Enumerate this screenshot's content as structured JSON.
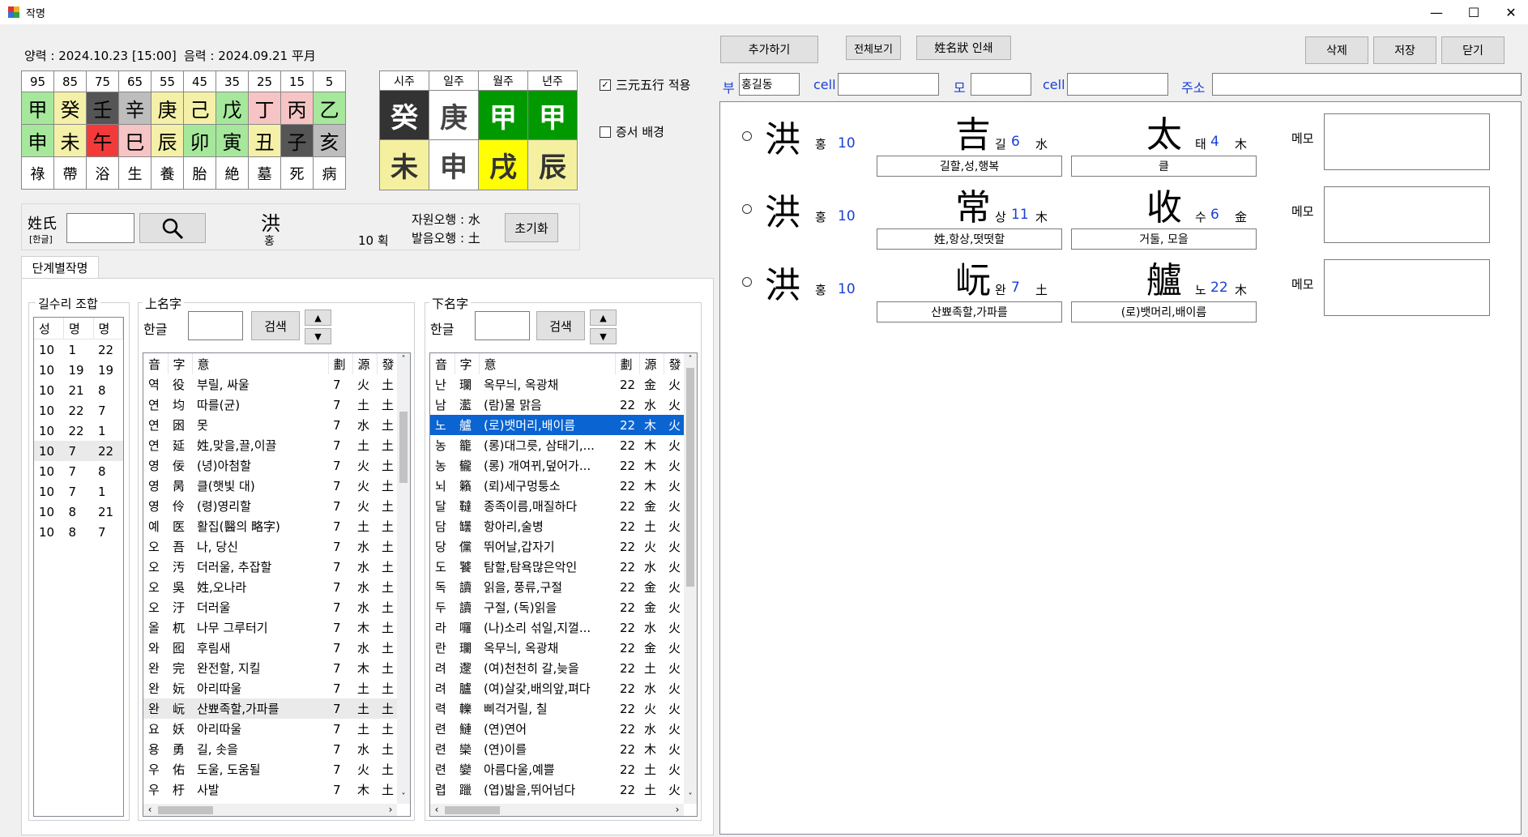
{
  "window": {
    "title": "작명",
    "min": "—",
    "max": "☐",
    "close": "✕"
  },
  "header": {
    "solar_label": "양력 : 2024.10.23 [15:00]",
    "lunar_label": "음력 : 2024.09.21 平月"
  },
  "daewoon": {
    "ages": [
      "95",
      "85",
      "75",
      "65",
      "55",
      "45",
      "35",
      "25",
      "15",
      "5"
    ],
    "stems": [
      "甲",
      "癸",
      "壬",
      "辛",
      "庚",
      "己",
      "戊",
      "丁",
      "丙",
      "乙"
    ],
    "branches": [
      "申",
      "未",
      "午",
      "巳",
      "辰",
      "卯",
      "寅",
      "丑",
      "子",
      "亥"
    ],
    "states": [
      "祿",
      "帶",
      "浴",
      "生",
      "養",
      "胎",
      "絶",
      "墓",
      "死",
      "病"
    ],
    "stem_colors": [
      "#a6e89b",
      "#f4f0a8",
      "#555555",
      "#bdbdbd",
      "#f4f0a8",
      "#f4f0a8",
      "#a6e89b",
      "#f6c4c4",
      "#f6c4c4",
      "#a6e89b"
    ],
    "branch_colors": [
      "#a6e89b",
      "#f4f0a8",
      "#f33a3a",
      "#f6c4c4",
      "#f4f0a8",
      "#a6e89b",
      "#a6e89b",
      "#f4f0a8",
      "#555555",
      "#bdbdbd"
    ]
  },
  "pillars": {
    "headers": [
      "시주",
      "일주",
      "월주",
      "년주"
    ],
    "stems": [
      "癸",
      "庚",
      "甲",
      "甲"
    ],
    "branches": [
      "未",
      "申",
      "戌",
      "辰"
    ],
    "stem_bg": [
      "#333333",
      "#ffffff",
      "#009a00",
      "#009a00"
    ],
    "stem_fg": [
      "#ffffff",
      "#444444",
      "#ffffff",
      "#ffffff"
    ],
    "branch_bg": [
      "#f4f0a0",
      "#ffffff",
      "#ffff00",
      "#f4f0a0"
    ],
    "branch_fg": [
      "#333333",
      "#444444",
      "#333333",
      "#333333"
    ]
  },
  "options": {
    "opt1": "三元五行 적용",
    "opt2": "증서 배경"
  },
  "surname": {
    "label": "姓氏",
    "sub": "[한글]",
    "value": "",
    "hanja": "洪",
    "reading": "홍",
    "strokes": "10 획",
    "jawon": "자원오행 : 水",
    "balum": "발음오행 : 土",
    "reset": "초기화"
  },
  "tab": {
    "label": "단계별작명"
  },
  "gilsu": {
    "title": "길수리 조합",
    "headers": [
      "성",
      "명",
      "명"
    ],
    "rows": [
      [
        "10",
        "1",
        "22"
      ],
      [
        "10",
        "19",
        "19"
      ],
      [
        "10",
        "21",
        "8"
      ],
      [
        "10",
        "22",
        "7"
      ],
      [
        "10",
        "22",
        "1"
      ],
      [
        "10",
        "7",
        "22"
      ],
      [
        "10",
        "7",
        "8"
      ],
      [
        "10",
        "7",
        "1"
      ],
      [
        "10",
        "8",
        "21"
      ],
      [
        "10",
        "8",
        "7"
      ]
    ]
  },
  "upper": {
    "title": "上名字",
    "hangul_label": "한글",
    "search": "검색",
    "headers": [
      "音",
      "字",
      "意",
      "劃",
      "源",
      "發"
    ],
    "rows": [
      [
        "역",
        "役",
        "부릴, 싸울",
        "7",
        "火",
        "土"
      ],
      [
        "연",
        "均",
        "따를(균)",
        "7",
        "土",
        "土"
      ],
      [
        "연",
        "囦",
        "못",
        "7",
        "水",
        "土"
      ],
      [
        "연",
        "延",
        "姓,맞을,끌,이끌",
        "7",
        "土",
        "土"
      ],
      [
        "영",
        "佞",
        "(녕)아첨할",
        "7",
        "火",
        "土"
      ],
      [
        "영",
        "昺",
        "클(햇빛 대)",
        "7",
        "火",
        "土"
      ],
      [
        "영",
        "伶",
        "(령)영리할",
        "7",
        "火",
        "土"
      ],
      [
        "예",
        "医",
        "활집(醫의 略字)",
        "7",
        "土",
        "土"
      ],
      [
        "오",
        "吾",
        "나, 당신",
        "7",
        "水",
        "土"
      ],
      [
        "오",
        "汚",
        "더러울, 추잡할",
        "7",
        "水",
        "土"
      ],
      [
        "오",
        "吳",
        "姓,오나라",
        "7",
        "水",
        "土"
      ],
      [
        "오",
        "汙",
        "더러울",
        "7",
        "水",
        "土"
      ],
      [
        "올",
        "杌",
        "나무 그루터기",
        "7",
        "木",
        "土"
      ],
      [
        "와",
        "囮",
        "후림새",
        "7",
        "水",
        "土"
      ],
      [
        "완",
        "完",
        "완전할, 지킬",
        "7",
        "木",
        "土"
      ],
      [
        "완",
        "妧",
        "아리따울",
        "7",
        "土",
        "土"
      ],
      [
        "완",
        "岏",
        "산뾰족할,가파를",
        "7",
        "土",
        "土"
      ],
      [
        "요",
        "妖",
        "아리따울",
        "7",
        "土",
        "土"
      ],
      [
        "용",
        "勇",
        "길, 솟을",
        "7",
        "水",
        "土"
      ],
      [
        "우",
        "佑",
        "도울, 도움될",
        "7",
        "火",
        "土"
      ],
      [
        "우",
        "杅",
        "사발",
        "7",
        "木",
        "土"
      ]
    ]
  },
  "lower": {
    "title": "下名字",
    "hangul_label": "한글",
    "search": "검색",
    "headers": [
      "音",
      "字",
      "意",
      "劃",
      "源",
      "發"
    ],
    "rows": [
      [
        "난",
        "瓓",
        "옥무늬, 옥광채",
        "22",
        "金",
        "火"
      ],
      [
        "남",
        "灆",
        "(람)물 맑음",
        "22",
        "水",
        "火"
      ],
      [
        "노",
        "艫",
        "(로)뱃머리,배이름",
        "22",
        "木",
        "火"
      ],
      [
        "농",
        "籠",
        "(롱)대그릇, 삼태기,...",
        "22",
        "木",
        "火"
      ],
      [
        "농",
        "龓",
        "(롱) 개여뀌,덮어가...",
        "22",
        "木",
        "火"
      ],
      [
        "뇌",
        "籟",
        "(뢰)세구멍퉁소",
        "22",
        "木",
        "火"
      ],
      [
        "달",
        "韃",
        "종족이름,매질하다",
        "22",
        "金",
        "火"
      ],
      [
        "담",
        "罎",
        "항아리,술병",
        "22",
        "土",
        "火"
      ],
      [
        "당",
        "儻",
        "뛰어날,갑자기",
        "22",
        "火",
        "火"
      ],
      [
        "도",
        "饕",
        "탐할,탐욕많은악인",
        "22",
        "水",
        "火"
      ],
      [
        "독",
        "讀",
        "읽을, 풍류,구절",
        "22",
        "金",
        "火"
      ],
      [
        "두",
        "讀",
        "구절, (독)읽을",
        "22",
        "金",
        "火"
      ],
      [
        "라",
        "囉",
        "(나)소리 섞일,지껄...",
        "22",
        "水",
        "火"
      ],
      [
        "란",
        "瓓",
        "옥무늬, 옥광채",
        "22",
        "金",
        "火"
      ],
      [
        "려",
        "邌",
        "(여)천천히 갈,늦을",
        "22",
        "土",
        "火"
      ],
      [
        "려",
        "臚",
        "(여)살갗,배의앞,펴다",
        "22",
        "水",
        "火"
      ],
      [
        "력",
        "轢",
        "삐걱거릴, 칠",
        "22",
        "火",
        "火"
      ],
      [
        "련",
        "鰱",
        "(연)연어",
        "22",
        "水",
        "火"
      ],
      [
        "련",
        "欒",
        "(연)이를",
        "22",
        "木",
        "火"
      ],
      [
        "련",
        "孌",
        "아름다울,예쁠",
        "22",
        "土",
        "火"
      ],
      [
        "렵",
        "躐",
        "(엽)밟을,뛰어넘다",
        "22",
        "土",
        "火"
      ]
    ]
  },
  "toolbar": {
    "add": "추가하기",
    "view_all": "전체보기",
    "print": "姓名狀 인쇄",
    "delete": "삭제",
    "save": "저장",
    "close": "닫기"
  },
  "family": {
    "father_label": "부",
    "father_value": "홍길동",
    "cell1_label": "cell",
    "cell1_value": "",
    "mother_label": "모",
    "mother_value": "",
    "cell2_label": "cell",
    "cell2_value": "",
    "address_label": "주소",
    "address_value": ""
  },
  "results": [
    {
      "sur": "洪",
      "sur_read": "홍",
      "sur_strokes": "10",
      "c1": "吉",
      "c1_read": "길",
      "c1_strokes": "6",
      "c1_el": "水",
      "c1_mean": "길할,성,행복",
      "c2": "太",
      "c2_read": "태",
      "c2_strokes": "4",
      "c2_el": "木",
      "c2_mean": "클",
      "memo": "메모"
    },
    {
      "sur": "洪",
      "sur_read": "홍",
      "sur_strokes": "10",
      "c1": "常",
      "c1_read": "상",
      "c1_strokes": "11",
      "c1_el": "木",
      "c1_mean": "姓,항상,떳떳할",
      "c2": "收",
      "c2_read": "수",
      "c2_strokes": "6",
      "c2_el": "金",
      "c2_mean": "거둘, 모을",
      "memo": "메모"
    },
    {
      "sur": "洪",
      "sur_read": "홍",
      "sur_strokes": "10",
      "c1": "岏",
      "c1_read": "완",
      "c1_strokes": "7",
      "c1_el": "土",
      "c1_mean": "산뾰족할,가파를",
      "c2": "艫",
      "c2_read": "노",
      "c2_strokes": "22",
      "c2_el": "木",
      "c2_mean": "(로)뱃머리,배이름",
      "memo": "메모"
    }
  ]
}
